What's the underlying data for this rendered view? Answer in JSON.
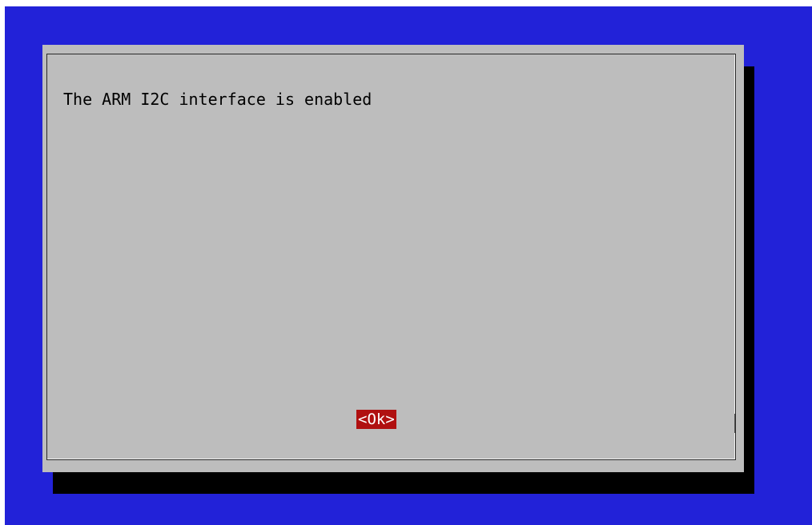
{
  "dialog": {
    "message": "The ARM I2C interface is enabled",
    "ok_label": "<Ok>"
  },
  "colors": {
    "background": "#2222d8",
    "dialog": "#bdbdbd",
    "shadow": "#000000",
    "button_active": "#b01010",
    "button_text": "#ffffff"
  }
}
